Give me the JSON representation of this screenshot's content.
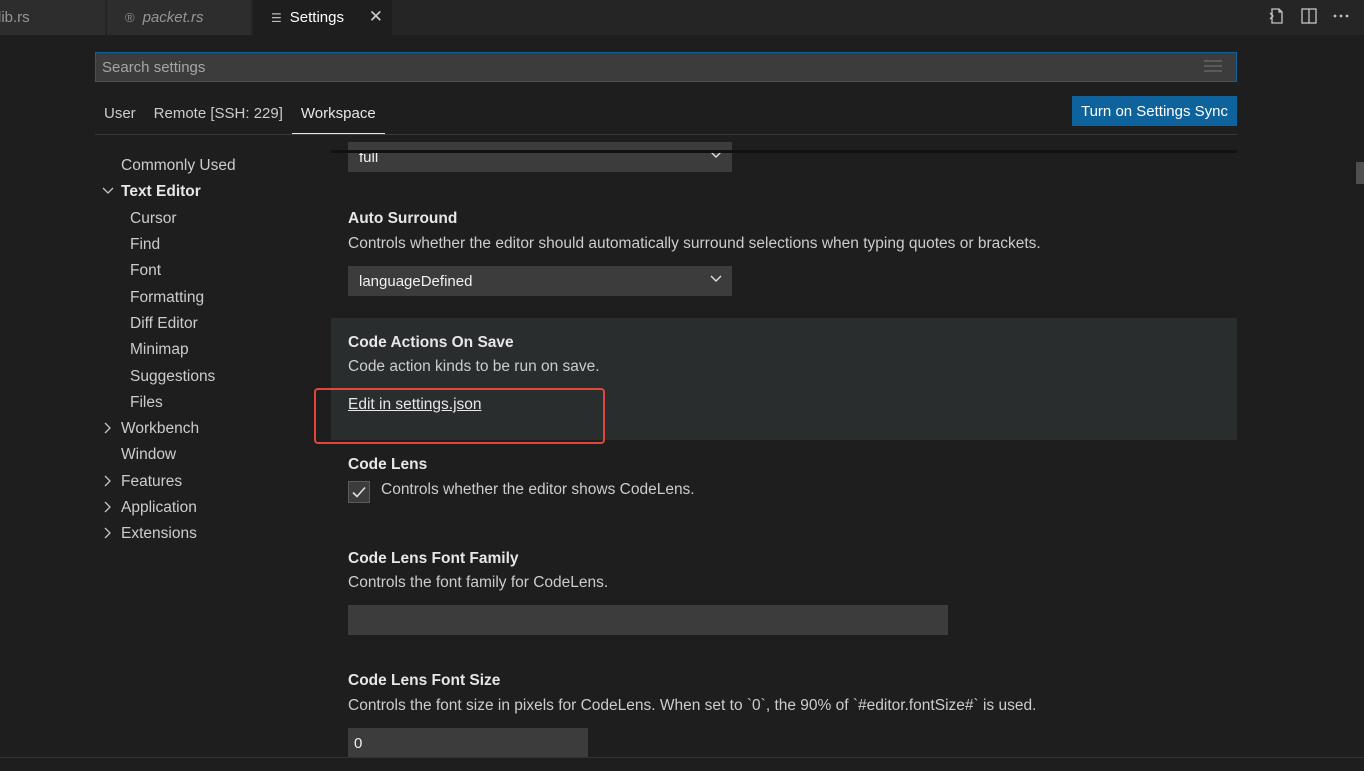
{
  "tabs": [
    {
      "label": "lib.rs"
    },
    {
      "label": "packet.rs"
    },
    {
      "label": "Settings"
    }
  ],
  "tab_actions": [
    "open-settings-json-icon",
    "split-editor-icon",
    "more-actions-icon"
  ],
  "search": {
    "placeholder": "Search settings"
  },
  "scopes": [
    {
      "label": "User"
    },
    {
      "label": "Remote [SSH: 229]"
    },
    {
      "label": "Workspace",
      "active": true
    }
  ],
  "sync_button": "Turn on Settings Sync",
  "toc": [
    {
      "label": "Commonly Used",
      "level": 0
    },
    {
      "label": "Text Editor",
      "level": 0,
      "expanded": true
    },
    {
      "label": "Cursor",
      "level": 1
    },
    {
      "label": "Find",
      "level": 1
    },
    {
      "label": "Font",
      "level": 1
    },
    {
      "label": "Formatting",
      "level": 1
    },
    {
      "label": "Diff Editor",
      "level": 1
    },
    {
      "label": "Minimap",
      "level": 1
    },
    {
      "label": "Suggestions",
      "level": 1
    },
    {
      "label": "Files",
      "level": 1
    },
    {
      "label": "Workbench",
      "level": 0,
      "expanded": false
    },
    {
      "label": "Window",
      "level": 0
    },
    {
      "label": "Features",
      "level": 0,
      "expanded": false
    },
    {
      "label": "Application",
      "level": 0,
      "expanded": false
    },
    {
      "label": "Extensions",
      "level": 0,
      "expanded": false
    }
  ],
  "settings": {
    "prev_select_value": "full",
    "auto_surround": {
      "title": "Auto Surround",
      "desc": "Controls whether the editor should automatically surround selections when typing quotes or brackets.",
      "value": "languageDefined"
    },
    "code_actions": {
      "title": "Code Actions On Save",
      "desc": "Code action kinds to be run on save.",
      "link": "Edit in settings.json"
    },
    "code_lens": {
      "title": "Code Lens",
      "desc": "Controls whether the editor shows CodeLens.",
      "checked": true
    },
    "code_lens_font_family": {
      "title": "Code Lens Font Family",
      "desc": "Controls the font family for CodeLens.",
      "value": ""
    },
    "code_lens_font_size": {
      "title": "Code Lens Font Size",
      "desc": "Controls the font size in pixels for CodeLens. When set to `0`, the 90% of `#editor.fontSize#` is used.",
      "value": "0"
    }
  },
  "colors": {
    "accent": "#0e639c",
    "annotation": "#e0463a"
  }
}
